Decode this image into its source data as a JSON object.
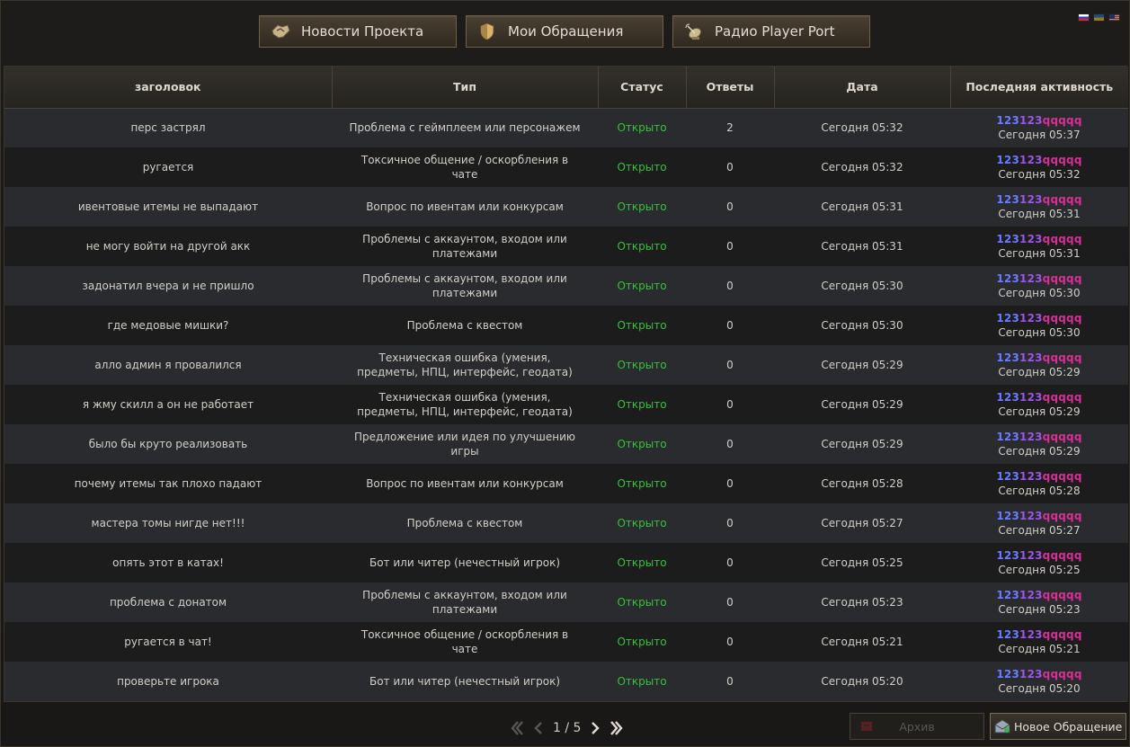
{
  "nav": {
    "buttons": [
      {
        "label": "Новости Проекта",
        "icon": "handshake-icon"
      },
      {
        "label": "Мои Обращения",
        "icon": "shield-icon"
      },
      {
        "label": "Радио Player Port",
        "icon": "satellite-dish-icon"
      }
    ],
    "flags": [
      "russian-flag-icon",
      "ukrainian-flag-icon",
      "us-flag-icon"
    ]
  },
  "table": {
    "headers": [
      "заголовок",
      "Тип",
      "Статус",
      "Ответы",
      "Дата",
      "Последняя активность"
    ],
    "user": {
      "part1": "123",
      "part2": "123",
      "part3": "qqqqq"
    },
    "rows": [
      {
        "title": "перс застрял",
        "type": "Проблема с геймплеем или персонажем",
        "status": "Открыто",
        "replies": "2",
        "date": "Сегодня 05:32",
        "last_time": "Сегодня 05:37"
      },
      {
        "title": "ругается",
        "type": "Токсичное общение / оскорбления в чате",
        "status": "Открыто",
        "replies": "0",
        "date": "Сегодня 05:32",
        "last_time": "Сегодня 05:32"
      },
      {
        "title": "ивентовые итемы не выпадают",
        "type": "Вопрос по ивентам или конкурсам",
        "status": "Открыто",
        "replies": "0",
        "date": "Сегодня 05:31",
        "last_time": "Сегодня 05:31"
      },
      {
        "title": "не могу войти на другой акк",
        "type": "Проблемы с аккаунтом, входом или платежами",
        "status": "Открыто",
        "replies": "0",
        "date": "Сегодня 05:31",
        "last_time": "Сегодня 05:31"
      },
      {
        "title": "задонатил вчера и не пришло",
        "type": "Проблемы с аккаунтом, входом или платежами",
        "status": "Открыто",
        "replies": "0",
        "date": "Сегодня 05:30",
        "last_time": "Сегодня 05:30"
      },
      {
        "title": "где медовые мишки?",
        "type": "Проблема с квестом",
        "status": "Открыто",
        "replies": "0",
        "date": "Сегодня 05:30",
        "last_time": "Сегодня 05:30"
      },
      {
        "title": "алло админ я провалился",
        "type": "Техническая ошибка (умения, предметы, НПЦ, интерфейс, геодата)",
        "status": "Открыто",
        "replies": "0",
        "date": "Сегодня 05:29",
        "last_time": "Сегодня 05:29"
      },
      {
        "title": "я жму скилл а он не работает",
        "type": "Техническая ошибка (умения, предметы, НПЦ, интерфейс, геодата)",
        "status": "Открыто",
        "replies": "0",
        "date": "Сегодня 05:29",
        "last_time": "Сегодня 05:29"
      },
      {
        "title": "было бы круто реализовать",
        "type": "Предложение или идея по улучшению игры",
        "status": "Открыто",
        "replies": "0",
        "date": "Сегодня 05:29",
        "last_time": "Сегодня 05:29"
      },
      {
        "title": "почему итемы так плохо падают",
        "type": "Вопрос по ивентам или конкурсам",
        "status": "Открыто",
        "replies": "0",
        "date": "Сегодня 05:28",
        "last_time": "Сегодня 05:28"
      },
      {
        "title": "мастера томы нигде нет!!!",
        "type": "Проблема с квестом",
        "status": "Открыто",
        "replies": "0",
        "date": "Сегодня 05:27",
        "last_time": "Сегодня 05:27"
      },
      {
        "title": "опять этот в катах!",
        "type": "Бот или читер (нечестный игрок)",
        "status": "Открыто",
        "replies": "0",
        "date": "Сегодня 05:25",
        "last_time": "Сегодня 05:25"
      },
      {
        "title": "проблема с донатом",
        "type": "Проблемы с аккаунтом, входом или платежами",
        "status": "Открыто",
        "replies": "0",
        "date": "Сегодня 05:23",
        "last_time": "Сегодня 05:23"
      },
      {
        "title": "ругается в чат!",
        "type": "Токсичное общение / оскорбления в чате",
        "status": "Открыто",
        "replies": "0",
        "date": "Сегодня 05:21",
        "last_time": "Сегодня 05:21"
      },
      {
        "title": "проверьте игрока",
        "type": "Бот или читер (нечестный игрок)",
        "status": "Открыто",
        "replies": "0",
        "date": "Сегодня 05:20",
        "last_time": "Сегодня 05:20"
      }
    ]
  },
  "pagination": {
    "current": "1",
    "separator": "/",
    "total": "5"
  },
  "footer": {
    "archive_label": "Архив",
    "new_ticket_label": "Новое Обращение"
  },
  "colors": {
    "status_open": "#38c03e",
    "user_part1": "#6b7bff",
    "user_part2": "#9a57e3",
    "user_part3": "#d72f96",
    "accent_border": "#6e5f46"
  }
}
